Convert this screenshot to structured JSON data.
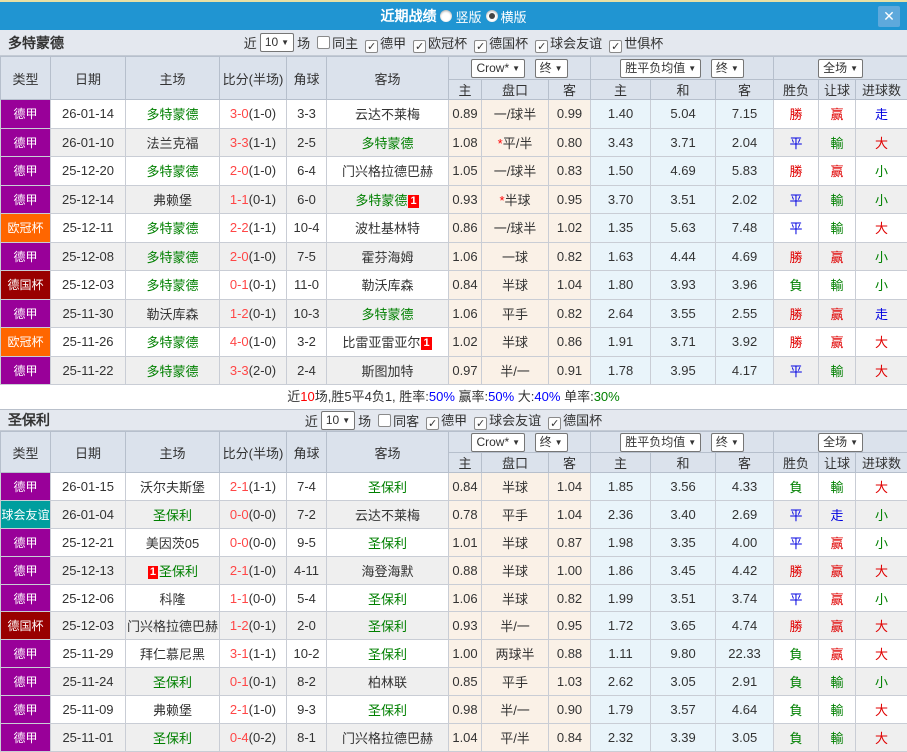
{
  "titlebar": {
    "title": "近期战绩",
    "vertical_label": "竖版",
    "horizontal_label": "横版",
    "vertical_checked": false,
    "horizontal_checked": true,
    "close_icon": "✕"
  },
  "ui": {
    "arrow": "▼",
    "check": "✓"
  },
  "colors": {
    "topbar": "#2095d2",
    "league_map": {
      "德甲": "#990099",
      "欧冠杯": "#ff6600",
      "德国杯": "#990000",
      "球会友谊": "#009e9e"
    },
    "result_map": {
      "勝": "#e00000",
      "平": "#0000e0",
      "負": "#008000",
      "赢": "#e00000",
      "輸": "#008000",
      "走": "#0000e0",
      "大": "#e00000",
      "小": "#008000"
    },
    "team_green": "#008000",
    "score_red": "#ff4646"
  },
  "table_header": {
    "type": "类型",
    "date": "日期",
    "home": "主场",
    "score": "比分(半场)",
    "corner": "角球",
    "away": "客场",
    "crow_select": "Crow*",
    "final_select": "终",
    "avg_select": "胜平负均值",
    "final_select2": "终",
    "fulltime_select": "全场",
    "odds_home": "主",
    "handicap": "盘口",
    "odds_away": "客",
    "avg_home": "主",
    "avg_draw": "和",
    "avg_away": "客",
    "result": "胜负",
    "let_goal": "让球",
    "goal_count": "进球数"
  },
  "sections": [
    {
      "team": "多特蒙德",
      "filter": {
        "near_label": "近",
        "count": "10",
        "games_label": "场",
        "same_label": "同主",
        "same_checked": false,
        "leagues": [
          {
            "label": "德甲",
            "checked": true
          },
          {
            "label": "欧冠杯",
            "checked": true
          },
          {
            "label": "德国杯",
            "checked": true
          },
          {
            "label": "球会友谊",
            "checked": true
          },
          {
            "label": "世俱杯",
            "checked": true
          }
        ]
      },
      "rows": [
        {
          "league": "德甲",
          "date": "26-01-14",
          "home": {
            "name": "多特蒙德",
            "green": true
          },
          "score": "3-0",
          "half": "(1-0)",
          "corner": "3-3",
          "away": {
            "name": "云达不莱梅"
          },
          "odds": [
            "0.89",
            "一/球半",
            "0.99"
          ],
          "avg": [
            "1.40",
            "5.04",
            "7.15"
          ],
          "result": "勝",
          "hc_result": "赢",
          "goals": "走"
        },
        {
          "league": "德甲",
          "date": "26-01-10",
          "home": {
            "name": "法兰克福"
          },
          "score": "3-3",
          "half": "(1-1)",
          "corner": "2-5",
          "away": {
            "name": "多特蒙德",
            "green": true
          },
          "odds": [
            "1.08",
            "*平/半",
            "0.80"
          ],
          "avg": [
            "3.43",
            "3.71",
            "2.04"
          ],
          "result": "平",
          "hc_result": "輸",
          "goals": "大"
        },
        {
          "league": "德甲",
          "date": "25-12-20",
          "home": {
            "name": "多特蒙德",
            "green": true
          },
          "score": "2-0",
          "half": "(1-0)",
          "corner": "6-4",
          "away": {
            "name": "门兴格拉德巴赫"
          },
          "odds": [
            "1.05",
            "一/球半",
            "0.83"
          ],
          "avg": [
            "1.50",
            "4.69",
            "5.83"
          ],
          "result": "勝",
          "hc_result": "赢",
          "goals": "小"
        },
        {
          "league": "德甲",
          "date": "25-12-14",
          "home": {
            "name": "弗赖堡"
          },
          "score": "1-1",
          "half": "(0-1)",
          "corner": "6-0",
          "away": {
            "name": "多特蒙德",
            "green": true,
            "badge": "after"
          },
          "odds": [
            "0.93",
            "*半球",
            "0.95"
          ],
          "avg": [
            "3.70",
            "3.51",
            "2.02"
          ],
          "result": "平",
          "hc_result": "輸",
          "goals": "小"
        },
        {
          "league": "欧冠杯",
          "date": "25-12-11",
          "home": {
            "name": "多特蒙德",
            "green": true
          },
          "score": "2-2",
          "half": "(1-1)",
          "corner": "10-4",
          "away": {
            "name": "波杜基林特"
          },
          "odds": [
            "0.86",
            "一/球半",
            "1.02"
          ],
          "avg": [
            "1.35",
            "5.63",
            "7.48"
          ],
          "result": "平",
          "hc_result": "輸",
          "goals": "大"
        },
        {
          "league": "德甲",
          "date": "25-12-08",
          "home": {
            "name": "多特蒙德",
            "green": true
          },
          "score": "2-0",
          "half": "(1-0)",
          "corner": "7-5",
          "away": {
            "name": "霍芬海姆"
          },
          "odds": [
            "1.06",
            "一球",
            "0.82"
          ],
          "avg": [
            "1.63",
            "4.44",
            "4.69"
          ],
          "result": "勝",
          "hc_result": "赢",
          "goals": "小"
        },
        {
          "league": "德国杯",
          "date": "25-12-03",
          "home": {
            "name": "多特蒙德",
            "green": true
          },
          "score": "0-1",
          "half": "(0-1)",
          "corner": "11-0",
          "away": {
            "name": "勒沃库森"
          },
          "odds": [
            "0.84",
            "半球",
            "1.04"
          ],
          "avg": [
            "1.80",
            "3.93",
            "3.96"
          ],
          "result": "負",
          "hc_result": "輸",
          "goals": "小"
        },
        {
          "league": "德甲",
          "date": "25-11-30",
          "home": {
            "name": "勒沃库森"
          },
          "score": "1-2",
          "half": "(0-1)",
          "corner": "10-3",
          "away": {
            "name": "多特蒙德",
            "green": true
          },
          "odds": [
            "1.06",
            "平手",
            "0.82"
          ],
          "avg": [
            "2.64",
            "3.55",
            "2.55"
          ],
          "result": "勝",
          "hc_result": "赢",
          "goals": "走"
        },
        {
          "league": "欧冠杯",
          "date": "25-11-26",
          "home": {
            "name": "多特蒙德",
            "green": true
          },
          "score": "4-0",
          "half": "(1-0)",
          "corner": "3-2",
          "away": {
            "name": "比雷亚雷亚尔",
            "badge": "after"
          },
          "odds": [
            "1.02",
            "半球",
            "0.86"
          ],
          "avg": [
            "1.91",
            "3.71",
            "3.92"
          ],
          "result": "勝",
          "hc_result": "赢",
          "goals": "大"
        },
        {
          "league": "德甲",
          "date": "25-11-22",
          "home": {
            "name": "多特蒙德",
            "green": true
          },
          "score": "3-3",
          "half": "(2-0)",
          "corner": "2-4",
          "away": {
            "name": "斯图加特"
          },
          "odds": [
            "0.97",
            "半/一",
            "0.91"
          ],
          "avg": [
            "1.78",
            "3.95",
            "4.17"
          ],
          "result": "平",
          "hc_result": "輸",
          "goals": "大"
        }
      ],
      "summary": [
        {
          "t": "近",
          "c": "#333333"
        },
        {
          "t": "10",
          "c": "#ff0000"
        },
        {
          "t": "场,胜5平4负1, 胜率:",
          "c": "#333333"
        },
        {
          "t": "50%",
          "c": "#0000ff"
        },
        {
          "t": " 赢率:",
          "c": "#333333"
        },
        {
          "t": "50%",
          "c": "#0000ff"
        },
        {
          "t": " 大:",
          "c": "#333333"
        },
        {
          "t": "40%",
          "c": "#0000ff"
        },
        {
          "t": " 单率:",
          "c": "#333333"
        },
        {
          "t": "30%",
          "c": "#008000"
        }
      ]
    },
    {
      "team": "圣保利",
      "filter": {
        "near_label": "近",
        "count": "10",
        "games_label": "场",
        "same_label": "同客",
        "same_checked": false,
        "leagues": [
          {
            "label": "德甲",
            "checked": true
          },
          {
            "label": "球会友谊",
            "checked": true
          },
          {
            "label": "德国杯",
            "checked": true
          }
        ]
      },
      "rows": [
        {
          "league": "德甲",
          "date": "26-01-15",
          "home": {
            "name": "沃尔夫斯堡"
          },
          "score": "2-1",
          "half": "(1-1)",
          "corner": "7-4",
          "away": {
            "name": "圣保利",
            "green": true
          },
          "odds": [
            "0.84",
            "半球",
            "1.04"
          ],
          "avg": [
            "1.85",
            "3.56",
            "4.33"
          ],
          "result": "負",
          "hc_result": "輸",
          "goals": "大"
        },
        {
          "league": "球会友谊",
          "date": "26-01-04",
          "home": {
            "name": "圣保利",
            "green": true
          },
          "score": "0-0",
          "half": "(0-0)",
          "corner": "7-2",
          "away": {
            "name": "云达不莱梅"
          },
          "odds": [
            "0.78",
            "平手",
            "1.04"
          ],
          "avg": [
            "2.36",
            "3.40",
            "2.69"
          ],
          "result": "平",
          "hc_result": "走",
          "goals": "小"
        },
        {
          "league": "德甲",
          "date": "25-12-21",
          "home": {
            "name": "美因茨05"
          },
          "score": "0-0",
          "half": "(0-0)",
          "corner": "9-5",
          "away": {
            "name": "圣保利",
            "green": true
          },
          "odds": [
            "1.01",
            "半球",
            "0.87"
          ],
          "avg": [
            "1.98",
            "3.35",
            "4.00"
          ],
          "result": "平",
          "hc_result": "赢",
          "goals": "小"
        },
        {
          "league": "德甲",
          "date": "25-12-13",
          "home": {
            "name": "圣保利",
            "green": true,
            "badge": "before"
          },
          "score": "2-1",
          "half": "(1-0)",
          "corner": "4-11",
          "away": {
            "name": "海登海默"
          },
          "odds": [
            "0.88",
            "半球",
            "1.00"
          ],
          "avg": [
            "1.86",
            "3.45",
            "4.42"
          ],
          "result": "勝",
          "hc_result": "赢",
          "goals": "大"
        },
        {
          "league": "德甲",
          "date": "25-12-06",
          "home": {
            "name": "科隆"
          },
          "score": "1-1",
          "half": "(0-0)",
          "corner": "5-4",
          "away": {
            "name": "圣保利",
            "green": true
          },
          "odds": [
            "1.06",
            "半球",
            "0.82"
          ],
          "avg": [
            "1.99",
            "3.51",
            "3.74"
          ],
          "result": "平",
          "hc_result": "赢",
          "goals": "小"
        },
        {
          "league": "德国杯",
          "date": "25-12-03",
          "home": {
            "name": "门兴格拉德巴赫"
          },
          "score": "1-2",
          "half": "(0-1)",
          "corner": "2-0",
          "away": {
            "name": "圣保利",
            "green": true
          },
          "odds": [
            "0.93",
            "半/一",
            "0.95"
          ],
          "avg": [
            "1.72",
            "3.65",
            "4.74"
          ],
          "result": "勝",
          "hc_result": "赢",
          "goals": "大"
        },
        {
          "league": "德甲",
          "date": "25-11-29",
          "home": {
            "name": "拜仁慕尼黑"
          },
          "score": "3-1",
          "half": "(1-1)",
          "corner": "10-2",
          "away": {
            "name": "圣保利",
            "green": true
          },
          "odds": [
            "1.00",
            "两球半",
            "0.88"
          ],
          "avg": [
            "1.11",
            "9.80",
            "22.33"
          ],
          "result": "負",
          "hc_result": "赢",
          "goals": "大"
        },
        {
          "league": "德甲",
          "date": "25-11-24",
          "home": {
            "name": "圣保利",
            "green": true
          },
          "score": "0-1",
          "half": "(0-1)",
          "corner": "8-2",
          "away": {
            "name": "柏林联"
          },
          "odds": [
            "0.85",
            "平手",
            "1.03"
          ],
          "avg": [
            "2.62",
            "3.05",
            "2.91"
          ],
          "result": "負",
          "hc_result": "輸",
          "goals": "小"
        },
        {
          "league": "德甲",
          "date": "25-11-09",
          "home": {
            "name": "弗赖堡"
          },
          "score": "2-1",
          "half": "(1-0)",
          "corner": "9-3",
          "away": {
            "name": "圣保利",
            "green": true
          },
          "odds": [
            "0.98",
            "半/一",
            "0.90"
          ],
          "avg": [
            "1.79",
            "3.57",
            "4.64"
          ],
          "result": "負",
          "hc_result": "輸",
          "goals": "大"
        },
        {
          "league": "德甲",
          "date": "25-11-01",
          "home": {
            "name": "圣保利",
            "green": true
          },
          "score": "0-4",
          "half": "(0-2)",
          "corner": "8-1",
          "away": {
            "name": "门兴格拉德巴赫"
          },
          "odds": [
            "1.04",
            "平/半",
            "0.84"
          ],
          "avg": [
            "2.32",
            "3.39",
            "3.05"
          ],
          "result": "負",
          "hc_result": "輸",
          "goals": "大"
        }
      ],
      "summary": null
    }
  ]
}
